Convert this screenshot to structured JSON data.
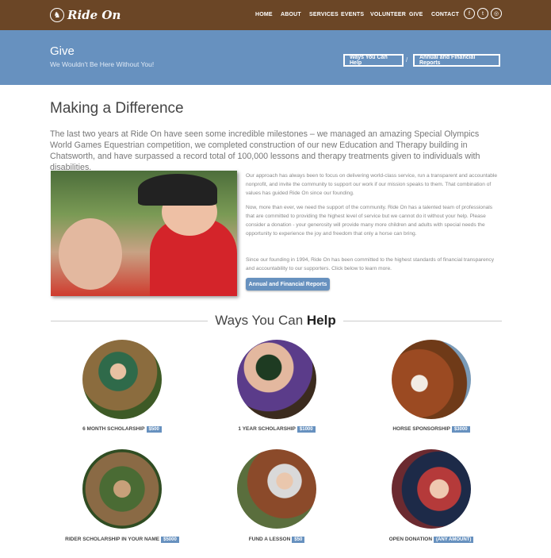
{
  "brand": {
    "name": "Ride On"
  },
  "nav": {
    "items": [
      "HOME",
      "ABOUT",
      "SERVICES",
      "EVENTS",
      "VOLUNTEER",
      "GIVE",
      "CONTACT"
    ],
    "social": [
      {
        "icon": "facebook-icon",
        "glyph": "f"
      },
      {
        "icon": "twitter-icon",
        "glyph": "t"
      },
      {
        "icon": "instagram-icon",
        "glyph": "◎"
      }
    ]
  },
  "banner": {
    "title": "Give",
    "subtitle": "We Wouldn't Be Here Without You!",
    "btn_ways": "Ways You Can Help",
    "separator": "/",
    "btn_reports": "Annual and Financial Reports"
  },
  "intro": {
    "heading": "Making a Difference",
    "lead": "The last two years at Ride On have seen some incredible milestones – we managed an amazing Special Olympics World Games Equestrian competition, we completed construction of our new Education and Therapy building in Chatsworth, and have surpassed a record total of 100,000 lessons and therapy treatments given to individuals with disabilities.",
    "p1": "Our approach has always been to focus on delivering world-class service, run a transparent and accountable nonprofit, and invite the community to support our work if our mission speaks to them. That combination of values has guided Ride On since our founding.",
    "p2": "Now, more than ever, we need the support of the community. Ride On has a talented team of professionals that are committed to providing the highest level of service but we cannot do it without your help. Please consider a donation - your generosity will provide many more children and adults with special needs the opportunity to experience the joy and freedom that only a horse can bring.",
    "p3": "Since our founding in 1994, Ride On has been committed to the highest standards of financial transparency and accountability to our supporters. Click below to learn more.",
    "button": "Annual and Financial Reports"
  },
  "help": {
    "title_light": "Ways You Can ",
    "title_bold": "Help",
    "options": [
      {
        "label": "6 MONTH SCHOLARSHIP",
        "price": "$500"
      },
      {
        "label": "1 YEAR SCHOLARSHIP",
        "price": "$1000"
      },
      {
        "label": "HORSE SPONSORSHIP",
        "price": "$3000"
      },
      {
        "label": "RIDER SCHOLARSHIP IN YOUR NAME",
        "price": "$5000"
      },
      {
        "label": "FUND A LESSON",
        "price": "$50"
      },
      {
        "label": "OPEN DONATION",
        "price": "(ANY AMOUNT)"
      }
    ]
  },
  "colors": {
    "nav_bg": "#6b4626",
    "band_bg": "#6791bf",
    "accent": "#6791bf"
  }
}
